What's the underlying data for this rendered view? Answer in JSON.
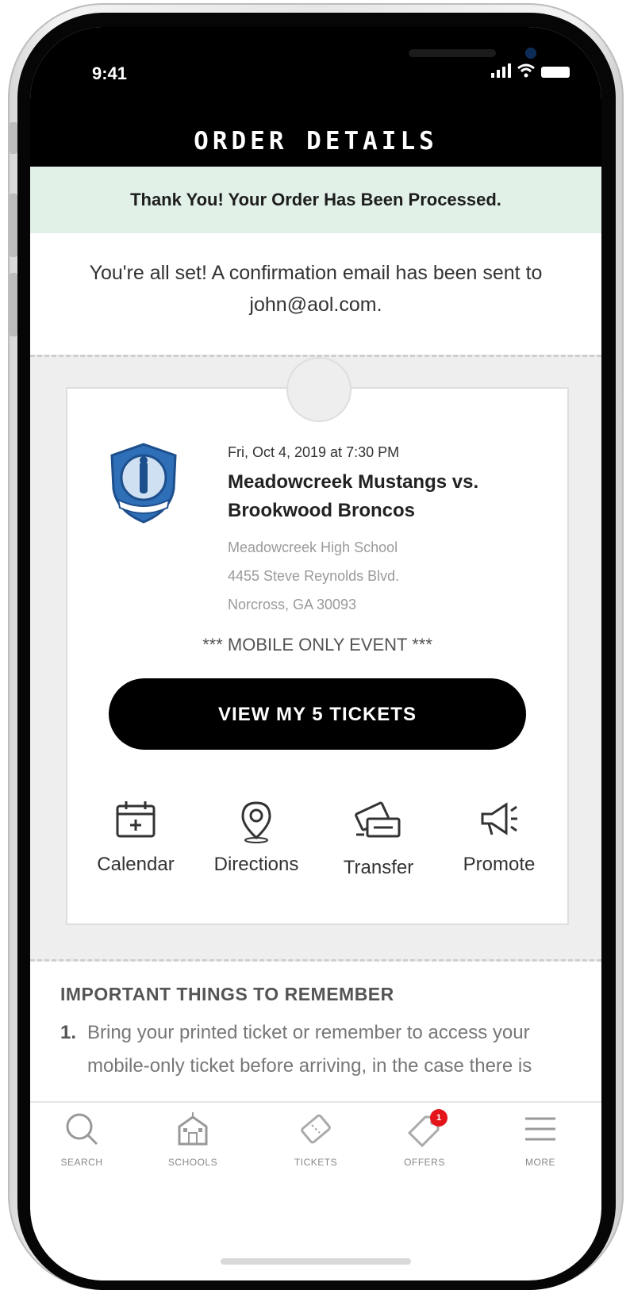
{
  "status_bar": {
    "time": "9:41"
  },
  "header": {
    "title": "ORDER DETAILS"
  },
  "banner": {
    "text": "Thank You! Your Order Has Been Processed."
  },
  "confirmation": {
    "text": "You're all set! A confirmation email has been sent to john@aol.com."
  },
  "event": {
    "date": "Fri, Oct 4, 2019 at 7:30 PM",
    "title": "Meadowcreek Mustangs vs. Brookwood Broncos",
    "venue": "Meadowcreek High School",
    "street": "4455 Steve Reynolds Blvd.",
    "city": "Norcross, GA 30093",
    "note": "*** MOBILE ONLY EVENT ***",
    "view_button": "VIEW MY 5 TICKETS"
  },
  "actions": [
    {
      "label": "Calendar",
      "icon": "calendar-icon"
    },
    {
      "label": "Directions",
      "icon": "location-pin-icon"
    },
    {
      "label": "Transfer",
      "icon": "ticket-transfer-icon"
    },
    {
      "label": "Promote",
      "icon": "megaphone-icon"
    }
  ],
  "important": {
    "heading": "IMPORTANT THINGS TO REMEMBER",
    "items": [
      {
        "number": "1.",
        "text": "Bring your printed ticket or remember to access your mobile-only ticket before arriving, in the case there is limited or no connectivity."
      }
    ]
  },
  "tabbar": {
    "items": [
      {
        "label": "SEARCH",
        "icon": "search-icon"
      },
      {
        "label": "SCHOOLS",
        "icon": "school-icon"
      },
      {
        "label": "TICKETS",
        "icon": "ticket-icon"
      },
      {
        "label": "OFFERS",
        "icon": "tag-icon",
        "badge": "1"
      },
      {
        "label": "MORE",
        "icon": "menu-icon"
      }
    ]
  },
  "colors": {
    "banner_bg": "#e2f1e8",
    "badge": "#e4141b",
    "primary_button": "#000000",
    "logo_blue": "#2f6fb8"
  }
}
